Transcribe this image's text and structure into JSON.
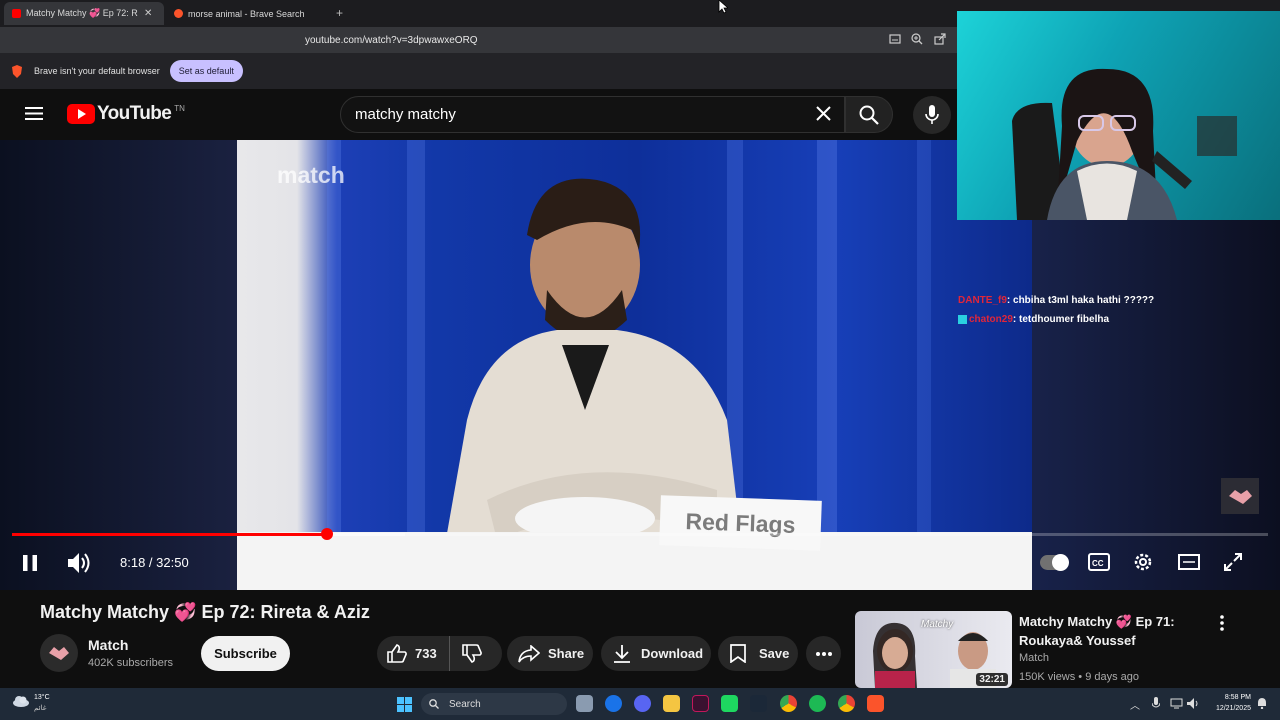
{
  "browser": {
    "tabs": [
      {
        "label": "Matchy Matchy 💞 Ep 72: Ri",
        "active": true
      },
      {
        "label": "morse animal - Brave Search",
        "active": false
      }
    ],
    "url": "youtube.com/watch?v=3dpwawxeORQ",
    "infobar_text": "Brave isn't your default browser",
    "set_default_label": "Set as default"
  },
  "youtube": {
    "logo_text": "YouTube",
    "logo_region": "TN",
    "search_value": "matchy matchy"
  },
  "player": {
    "time_current": "8:18",
    "time_total": "32:50",
    "time_display": "8:18 / 32:50",
    "progress_fraction": 0.251,
    "video_watermark": "match",
    "video_sign": "Red Flags"
  },
  "stream_chat": [
    {
      "user": "DANTE_f9",
      "message": ": chbiha t3ml haka hathi ?????"
    },
    {
      "user": "chaton29",
      "message": ": tetdhoumer fibelha"
    }
  ],
  "video_info": {
    "title": "Matchy Matchy 💞 Ep 72: Rireta & Aziz",
    "channel": "Match",
    "subscribers": "402K subscribers",
    "subscribe_label": "Subscribe",
    "likes": "733",
    "share_label": "Share",
    "download_label": "Download",
    "save_label": "Save"
  },
  "recommended": {
    "title": "Matchy Matchy 💞 Ep 71: Roukaya& Youssef",
    "channel": "Match",
    "meta": "150K views • 9 days ago",
    "duration": "32:21"
  },
  "taskbar": {
    "weather_temp": "13°C",
    "weather_desc": "غائم",
    "search_label": "Search",
    "time": "8:58 PM",
    "date": "12/21/2025"
  },
  "colors": {
    "yt_red": "#ff0000",
    "brave_orange": "#fb542b",
    "set_default_bg": "#c8c0ff",
    "chat_user1": "#e0263a",
    "chat_user2": "#e0263a"
  }
}
